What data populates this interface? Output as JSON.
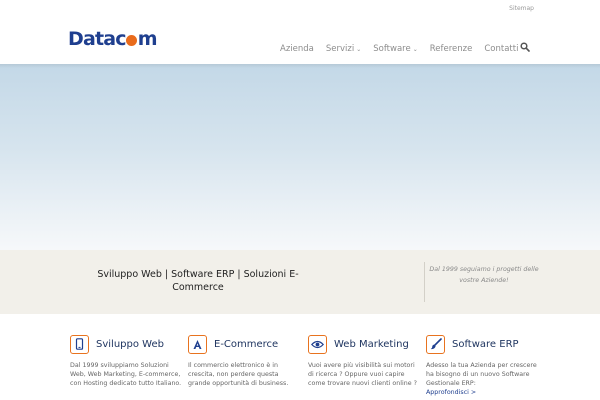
{
  "topbar": {
    "sitemap_label": "Sitemap"
  },
  "brand": {
    "logo_prefix": "Datac",
    "logo_suffix": "m",
    "logo_color": "#1f3f8f",
    "logo_accent": "#e96b1c"
  },
  "nav": {
    "items": [
      {
        "label": "Azienda",
        "has_dropdown": false
      },
      {
        "label": "Servizi",
        "has_dropdown": true
      },
      {
        "label": "Software",
        "has_dropdown": true
      },
      {
        "label": "Referenze",
        "has_dropdown": false
      },
      {
        "label": "Contatti",
        "has_dropdown": false
      }
    ],
    "search_icon": "search-icon"
  },
  "tagline": {
    "title": "Sviluppo Web | Software ERP | Soluzioni E-Commerce",
    "quote": "Dal 1999 seguiamo i progetti delle vostre Aziende!"
  },
  "features": [
    {
      "icon": "smartphone-icon",
      "title": "Sviluppo Web",
      "text": "Dal 1999 sviluppiamo Soluzioni Web, Web Marketing, E-commerce, con Hosting dedicato tutto Italiano.",
      "link": ""
    },
    {
      "icon": "letter-a-icon",
      "title": "E-Commerce",
      "text": "Il commercio elettronico è in crescita, non perdere questa grande  opportunità di business.",
      "link": ""
    },
    {
      "icon": "eye-icon",
      "title": "Web Marketing",
      "text": "Vuoi avere più visibilità sui motori di ricerca ? Oppure vuoi capire come trovare nuovi clienti online ?",
      "link": ""
    },
    {
      "icon": "brush-icon",
      "title": "Software ERP",
      "text": "Adesso la tua Azienda per crescere ha bisogno di un nuovo Software Gestionale ERP:",
      "link": "Approfondisci >"
    }
  ],
  "colors": {
    "accent": "#e8731f",
    "heading": "#1f3560",
    "band_bg": "#f2f0ea",
    "hero_top": "#c3d8e7"
  }
}
